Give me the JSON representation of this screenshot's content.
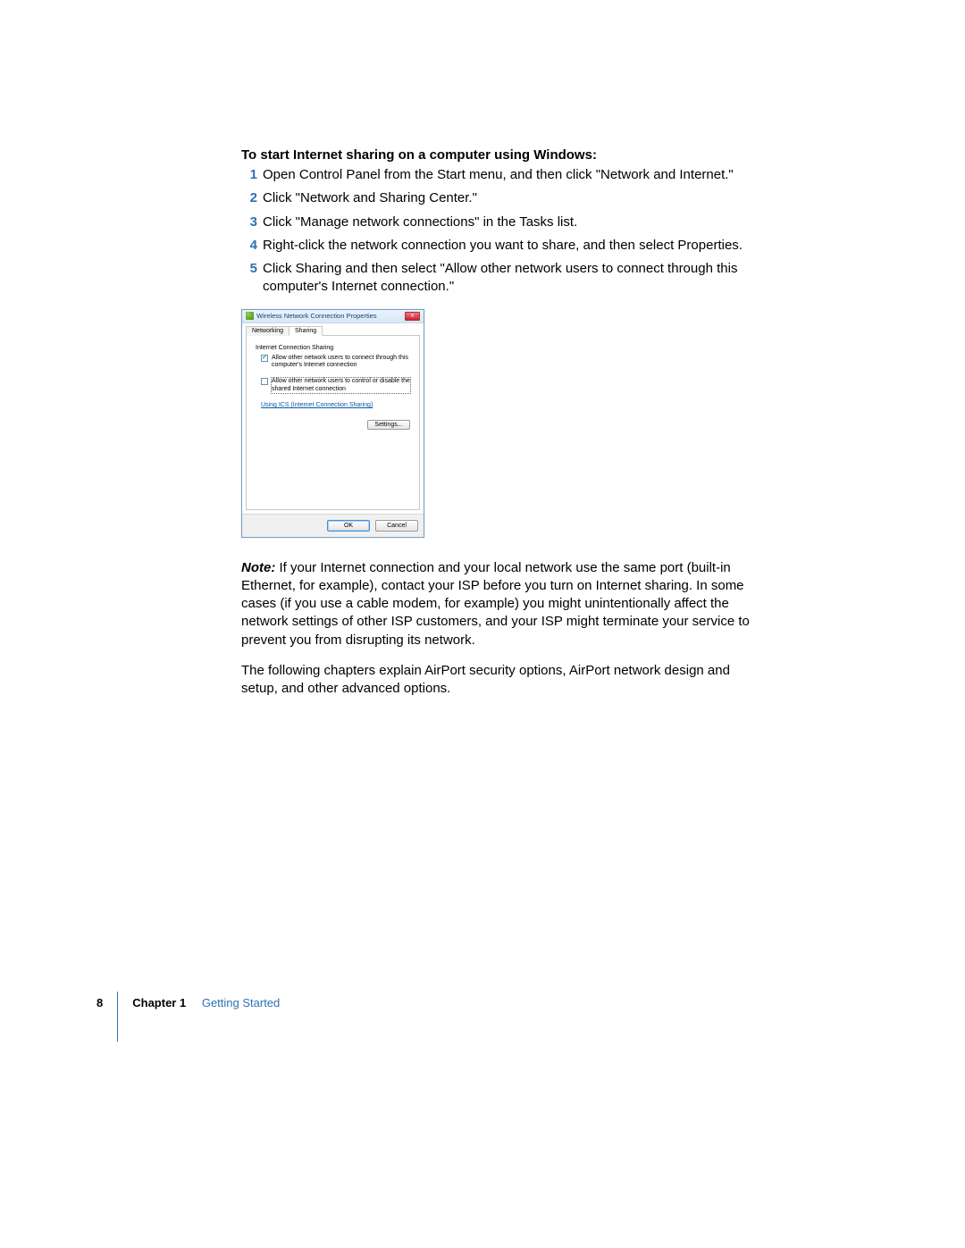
{
  "heading": "To start Internet sharing on a computer using Windows:",
  "steps": [
    {
      "n": "1",
      "t": "Open Control Panel from the Start menu, and then click \"Network and Internet.\""
    },
    {
      "n": "2",
      "t": "Click \"Network and Sharing Center.\""
    },
    {
      "n": "3",
      "t": "Click \"Manage network connections\" in the Tasks list."
    },
    {
      "n": "4",
      "t": "Right-click the network connection you want to share, and then select Properties."
    },
    {
      "n": "5",
      "t": "Click Sharing and then select \"Allow other network users to connect through this computer's Internet connection.\""
    }
  ],
  "dialog": {
    "title": "Wireless Network Connection Properties",
    "tabs": {
      "networking": "Networking",
      "sharing": "Sharing"
    },
    "group_title": "Internet Connection Sharing",
    "check1": "Allow other network users to connect through this computer's Internet connection",
    "check2": "Allow other network users to control or disable the shared Internet connection",
    "link": "Using ICS (Internet Connection Sharing)",
    "settings_btn": "Settings...",
    "ok": "OK",
    "cancel": "Cancel"
  },
  "note_label": "Note:",
  "note_body": "  If your Internet connection and your local network use the same port (built-in Ethernet, for example), contact your ISP before you turn on Internet sharing. In some cases (if you use a cable modem, for example) you might unintentionally affect the network settings of other ISP customers, and your ISP might terminate your service to prevent you from disrupting its network.",
  "para2": "The following chapters explain AirPort security options, AirPort network design and setup, and other advanced options.",
  "footer": {
    "page": "8",
    "chapter_label": "Chapter 1",
    "chapter_title": "Getting Started"
  }
}
